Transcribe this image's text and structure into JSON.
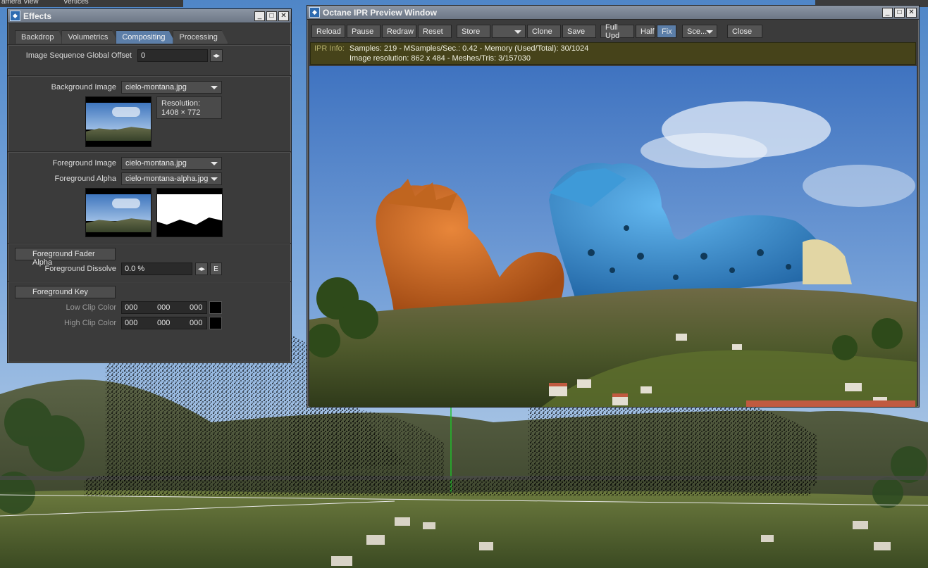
{
  "viewport": {
    "view_label": "amera View",
    "mode_label": "Vertices"
  },
  "effects": {
    "title": "Effects",
    "tabs": [
      "Backdrop",
      "Volumetrics",
      "Compositing",
      "Processing"
    ],
    "active_tab": "Compositing",
    "global_offset_label": "Image Sequence Global Offset",
    "global_offset_value": "0",
    "background_image_label": "Background Image",
    "background_image_value": "cielo-montana.jpg",
    "resolution_label": "Resolution:",
    "resolution_value": "1408 × 772",
    "foreground_image_label": "Foreground Image",
    "foreground_image_value": "cielo-montana.jpg",
    "foreground_alpha_label": "Foreground Alpha",
    "foreground_alpha_value": "cielo-montana-alpha.jpg",
    "fader_alpha_label": "Foreground Fader Alpha",
    "dissolve_label": "Foreground Dissolve",
    "dissolve_value": "0.0 %",
    "envelope_label": "E",
    "key_label": "Foreground Key",
    "low_clip_label": "Low Clip Color",
    "high_clip_label": "High Clip Color",
    "low_clip_values": [
      "000",
      "000",
      "000"
    ],
    "high_clip_values": [
      "000",
      "000",
      "000"
    ]
  },
  "ipr": {
    "title": "Octane IPR Preview Window",
    "buttons": {
      "reload": "Reload",
      "pause": "Pause",
      "redraw": "Redraw",
      "reset": "Reset",
      "store": "Store",
      "clone": "Clone",
      "save": "Save",
      "full_upd": "Full Upd",
      "half": "Half",
      "fix": "Fix",
      "scene": "Sce...",
      "close": "Close"
    },
    "info_label": "IPR Info:",
    "info_line1": "Samples: 219  -  MSamples/Sec.: 0.42  -  Memory (Used/Total): 30/1024",
    "info_line2": "Image resolution: 862 x 484  -  Meshes/Tris: 3/157030"
  },
  "colors": {
    "active_tab": "#5c7ea8",
    "info_bar": "#46431a",
    "orange_dragon": "#d0661f",
    "blue_dragon": "#3f9ee0"
  }
}
